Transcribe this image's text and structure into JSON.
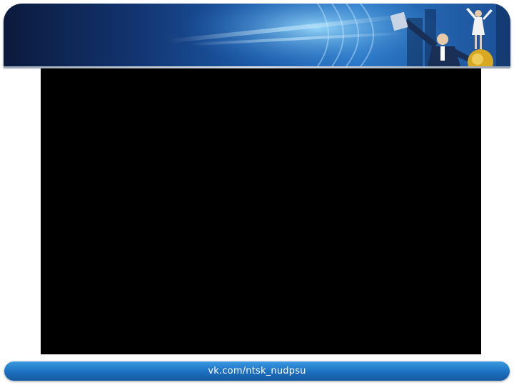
{
  "footer": {
    "link_text": "vk.com/ntsk_nudpsu"
  },
  "colors": {
    "header_dark": "#0b1a3c",
    "header_light": "#2a78c8",
    "footer_blue": "#1d6fc0",
    "content_bg": "#000000",
    "page_bg": "#ffffff"
  },
  "icons": {
    "header_image": "businesspeople-jumping-banner"
  }
}
